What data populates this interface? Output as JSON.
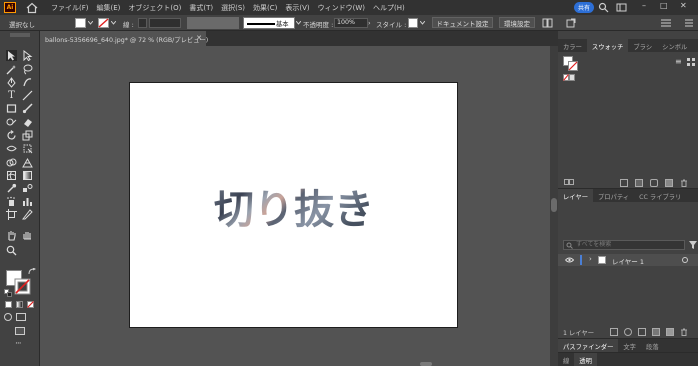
{
  "menu": {
    "app_logo": "Ai",
    "items": [
      "ファイル(F)",
      "編集(E)",
      "オブジェクト(O)",
      "書式(T)",
      "選択(S)",
      "効果(C)",
      "表示(V)",
      "ウィンドウ(W)",
      "ヘルプ(H)"
    ],
    "share_label": "共有",
    "window_controls": [
      "–",
      "□",
      "✕"
    ]
  },
  "control": {
    "selection_label": "選択なし",
    "stroke_label": "線 :",
    "stroke_style": "基本",
    "opacity_label": "不透明度 :",
    "opacity_value": "100%",
    "style_label": "スタイル :",
    "doc_setup": "ドキュメント設定",
    "prefs": "環境設定"
  },
  "document": {
    "tab_title": "ballons-5356696_640.jpg* @ 72 % (RGB/プレビュー)",
    "close": "✕",
    "artwork_text": "切り抜き"
  },
  "swatches_panel": {
    "tabs": [
      "カラー",
      "スウォッチ",
      "ブラシ",
      "シンボル"
    ],
    "active": 1,
    "menu_icon": "≡"
  },
  "layers_panel": {
    "tabs": [
      "レイヤー",
      "プロパティ",
      "CC ライブラリ"
    ],
    "active": 0,
    "search_placeholder": "すべてを検索",
    "layer_name": "レイヤー 1",
    "layer_count": "1 レイヤー"
  },
  "pathfinder_panel": {
    "tabs": [
      "パスファインダー",
      "文字",
      "段落"
    ],
    "active": 0
  },
  "bottom_tabs": [
    "線",
    "透明"
  ],
  "colors": {
    "menubar": "#323232",
    "panel": "#424242",
    "pasteboard": "#535353",
    "accent": "#2d6fd6",
    "layer_color": "#4a7fd6"
  }
}
